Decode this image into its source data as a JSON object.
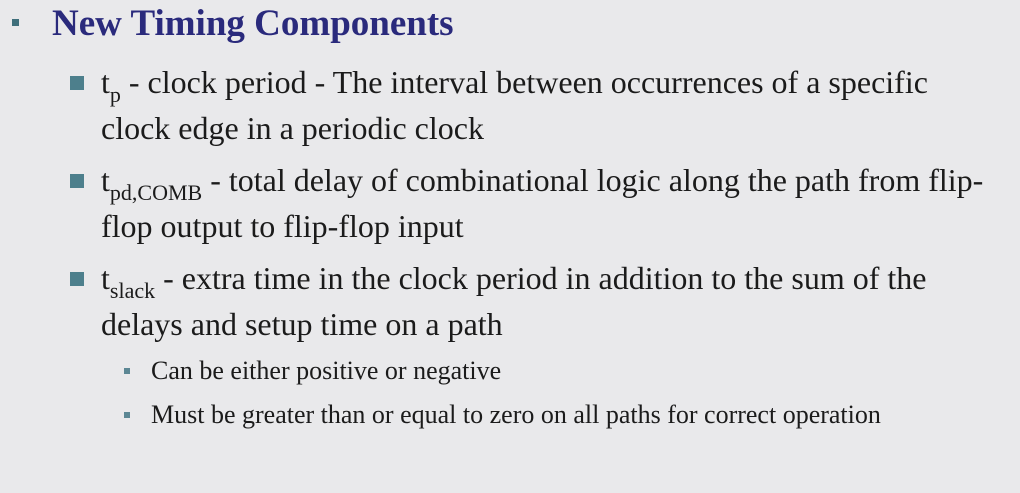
{
  "slide": {
    "title": "New Timing Components",
    "items": [
      {
        "symbol_base": "t",
        "symbol_sub": "p",
        "text": " - clock period - The interval between occurrences of a specific clock edge in a periodic clock"
      },
      {
        "symbol_base": "t",
        "symbol_sub": "pd,COMB",
        "text": " - total delay of combinational logic along the path from flip-flop output to flip-flop input"
      },
      {
        "symbol_base": "t",
        "symbol_sub": "slack",
        "text": " - extra time in the clock period in addition to the sum of the delays and setup time on a path"
      }
    ],
    "sub_items": [
      {
        "text": "Can be either positive or negative"
      },
      {
        "text": "Must be greater than or equal to zero on all paths for correct operation"
      }
    ]
  },
  "colors": {
    "background": "#e9e9eb",
    "title": "#2a2a7c",
    "bullet": "#4d7f8c",
    "text": "#1b1b1b"
  }
}
